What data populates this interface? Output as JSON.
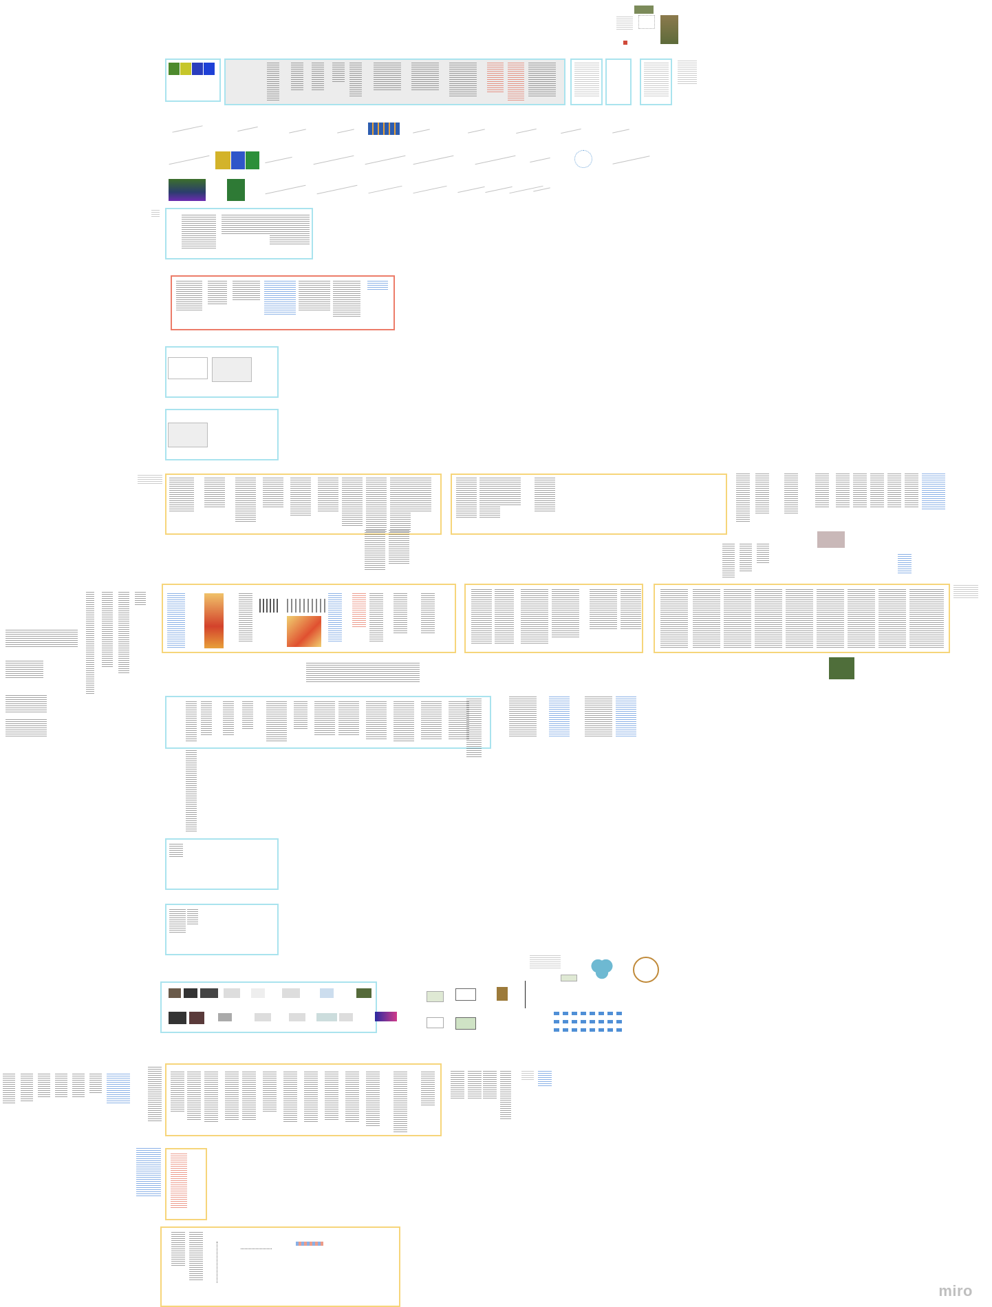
{
  "app": {
    "name": "Miro",
    "logo_text": "miro"
  },
  "colors": {
    "frame_cyan": "#a9e3ee",
    "frame_yellow": "#f6d57a",
    "frame_red": "#ec7b68",
    "text_blue": "#3a7bd5",
    "text_red": "#e0563e"
  }
}
